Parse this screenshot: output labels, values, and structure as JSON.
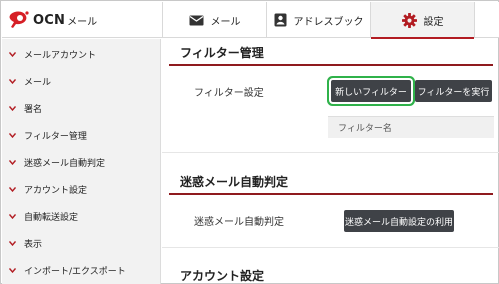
{
  "header": {
    "logo_text": "OCN",
    "logo_sub": "メール",
    "tabs": [
      {
        "label": "メール",
        "icon": "mail-icon"
      },
      {
        "label": "アドレスブック",
        "icon": "addressbook-icon"
      },
      {
        "label": "設定",
        "icon": "gear-icon",
        "active": true
      }
    ]
  },
  "sidebar": {
    "items": [
      {
        "label": "メールアカウント"
      },
      {
        "label": "メール"
      },
      {
        "label": "署名"
      },
      {
        "label": "フィルター管理"
      },
      {
        "label": "迷惑メール自動判定"
      },
      {
        "label": "アカウント設定"
      },
      {
        "label": "自動転送設定"
      },
      {
        "label": "表示"
      },
      {
        "label": "インポート/エクスポート"
      }
    ]
  },
  "main": {
    "filter_section": {
      "title": "フィルター管理",
      "row_label": "フィルター設定",
      "new_filter_button": "新しいフィルター",
      "run_filter_button": "フィルターを実行",
      "table_header": "フィルター名"
    },
    "spam_section": {
      "title": "迷惑メール自動判定",
      "row_label": "迷惑メール自動判定",
      "button": "迷惑メール自動設定の利用"
    },
    "account_section": {
      "title": "アカウント設定"
    }
  },
  "colors": {
    "accent_red": "#b21c22",
    "section_line": "#8f1a1e",
    "button_dark": "#3f4247",
    "highlight_green": "#2fb24a",
    "sidebar_bg": "#f2f2f2"
  }
}
